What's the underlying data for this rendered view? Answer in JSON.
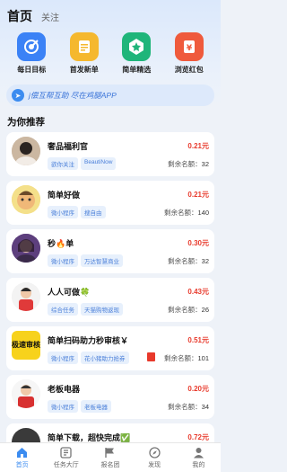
{
  "header": {
    "tabs": [
      "首页",
      "关注"
    ]
  },
  "quick_actions": [
    {
      "label": "每日目标",
      "icon": "target-icon",
      "color": "#3b82f6"
    },
    {
      "label": "首发新单",
      "icon": "document-icon",
      "color": "#f5b82e"
    },
    {
      "label": "简单精选",
      "icon": "star-badge-icon",
      "color": "#1fb57a"
    },
    {
      "label": "浏览红包",
      "icon": "red-envelope-icon",
      "color": "#ef5a3c"
    }
  ],
  "notice": {
    "text": "j偿互帮互助 尽在鸡腿APP",
    "icon": "send-icon"
  },
  "section_title": "为你推荐",
  "tasks": [
    {
      "title": "奢品福利官",
      "price": "0.21元",
      "tags": [
        "欲你关注",
        "BeautiNow"
      ],
      "remain_label": "剩余名额：",
      "remain": "32"
    },
    {
      "title": "简单好做",
      "price": "0.21元",
      "tags": [
        "微小程序",
        "搜自由"
      ],
      "remain_label": "剩余名额：",
      "remain": "140"
    },
    {
      "title": "秒🔥单",
      "price": "0.30元",
      "tags": [
        "微小程序",
        "万达智慧商业"
      ],
      "remain_label": "剩余名额：",
      "remain": "32"
    },
    {
      "title": "人人可做🍀",
      "price": "0.43元",
      "tags": [
        "综合任务",
        "天猫购物返现"
      ],
      "remain_label": "剩余名额：",
      "remain": "26"
    },
    {
      "title": "简单扫码助力秒审核￥",
      "price": "0.51元",
      "tags": [
        "微小程序",
        "花小猪助力抢券"
      ],
      "remain_label": "剩余名额：",
      "remain": "101"
    },
    {
      "title": "老板电器",
      "price": "0.20元",
      "tags": [
        "微小程序",
        "老板电器"
      ],
      "remain_label": "剩余名额：",
      "remain": "34"
    },
    {
      "title": "简单下载，超快完成✅",
      "price": "0.72元",
      "tags": [],
      "remain_label": "",
      "remain": ""
    }
  ],
  "avatar_badge_text": "极速审核",
  "bottom_nav": [
    {
      "label": "首页",
      "icon": "home-icon",
      "active": true
    },
    {
      "label": "任务大厅",
      "icon": "tasks-icon",
      "active": false
    },
    {
      "label": "报名团",
      "icon": "flag-icon",
      "active": false
    },
    {
      "label": "发现",
      "icon": "compass-icon",
      "active": false
    },
    {
      "label": "我的",
      "icon": "user-icon",
      "active": false
    }
  ]
}
